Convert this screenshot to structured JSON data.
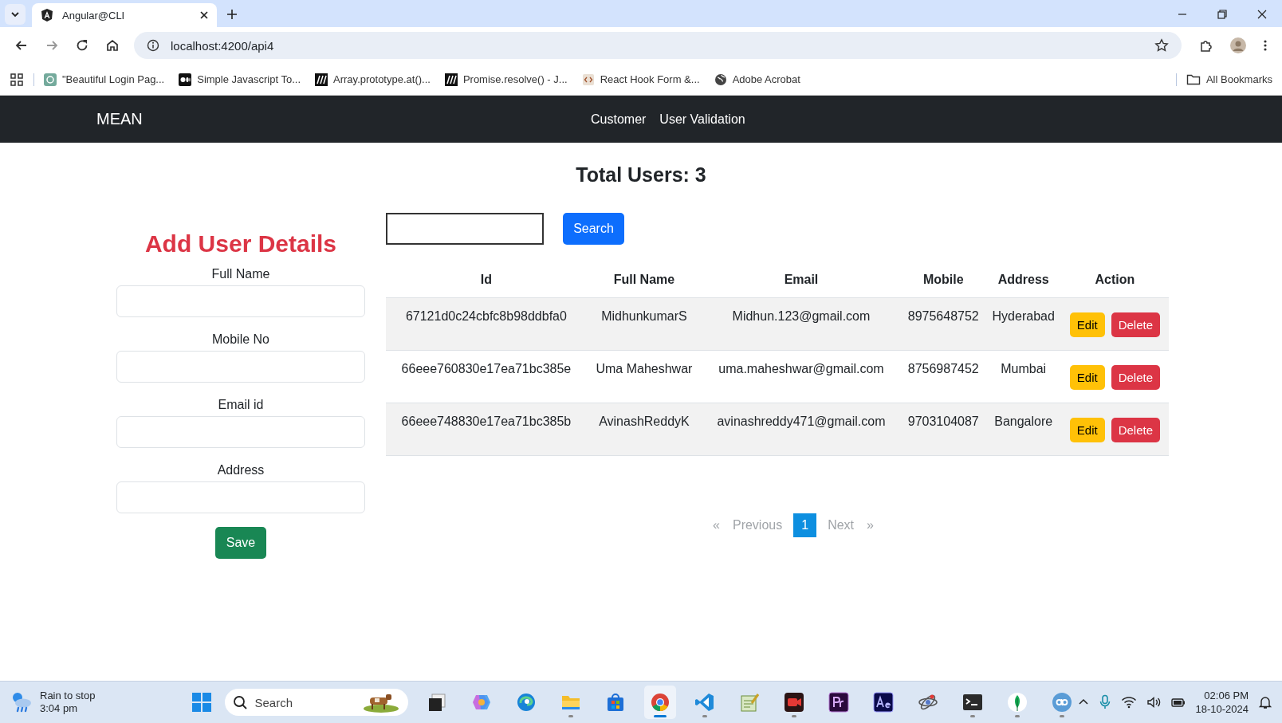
{
  "browser": {
    "tab": {
      "title": "Angular@CLI"
    },
    "address": "localhost:4200/api4",
    "bookmarks": [
      {
        "label": "\"Beautiful Login Pag...",
        "kind": "chat"
      },
      {
        "label": "Simple Javascript To...",
        "kind": "medium"
      },
      {
        "label": "Array.prototype.at()...",
        "kind": "mdn"
      },
      {
        "label": "Promise.resolve() - J...",
        "kind": "mdn"
      },
      {
        "label": "React Hook Form &...",
        "kind": "code"
      },
      {
        "label": "Adobe Acrobat",
        "kind": "globe"
      }
    ],
    "all_bookmarks": "All Bookmarks"
  },
  "navbar": {
    "brand": "MEAN",
    "links": [
      {
        "label": "Customer"
      },
      {
        "label": "User Validation"
      }
    ]
  },
  "heading": "Total Users: 3",
  "form": {
    "title": "Add User Details",
    "fields": [
      {
        "label": "Full Name"
      },
      {
        "label": "Mobile No"
      },
      {
        "label": "Email id"
      },
      {
        "label": "Address"
      }
    ],
    "save": "Save"
  },
  "search": {
    "button": "Search"
  },
  "table": {
    "columns": [
      "Id",
      "Full Name",
      "Email",
      "Mobile",
      "Address",
      "Action"
    ],
    "rows": [
      {
        "cells": [
          "67121d0c24cbfc8b98ddbfa0",
          "MidhunkumarS",
          "Midhun.123@gmail.com",
          "8975648752",
          "Hyderabad"
        ],
        "edit": "Edit",
        "delete": "Delete"
      },
      {
        "cells": [
          "66eee760830e17ea71bc385e",
          "Uma Maheshwar",
          "uma.maheshwar@gmail.com",
          "8756987452",
          "Mumbai"
        ],
        "edit": "Edit",
        "delete": "Delete"
      },
      {
        "cells": [
          "66eee748830e17ea71bc385b",
          "AvinashReddyK",
          "avinashreddy471@gmail.com",
          "9703104087",
          "Bangalore"
        ],
        "edit": "Edit",
        "delete": "Delete"
      }
    ]
  },
  "pagination": [
    {
      "label": "«",
      "selected": false,
      "disabled": true
    },
    {
      "label": "Previous",
      "selected": false,
      "disabled": true
    },
    {
      "label": "1",
      "selected": true,
      "disabled": false
    },
    {
      "label": "Next",
      "selected": false,
      "disabled": true
    },
    {
      "label": "»",
      "selected": false,
      "disabled": true
    }
  ],
  "taskbar": {
    "weather": {
      "title": "Rain to stop",
      "time": "3:04 pm"
    },
    "search": {
      "placeholder": "Search"
    },
    "apps": [
      {
        "kind": "files-stack",
        "running": false,
        "selected": false
      },
      {
        "kind": "copilot",
        "running": false,
        "selected": false
      },
      {
        "kind": "edge",
        "running": false,
        "selected": false
      },
      {
        "kind": "folder",
        "running": true,
        "selected": false
      },
      {
        "kind": "store",
        "running": false,
        "selected": false
      },
      {
        "kind": "chrome",
        "running": true,
        "selected": true
      },
      {
        "kind": "vscode",
        "running": true,
        "selected": false
      },
      {
        "kind": "notepad",
        "running": false,
        "selected": false
      },
      {
        "kind": "recorder",
        "running": true,
        "selected": false
      },
      {
        "kind": "pr",
        "running": false,
        "selected": false
      },
      {
        "kind": "ae",
        "running": false,
        "selected": false
      },
      {
        "kind": "atom",
        "running": false,
        "selected": false
      },
      {
        "kind": "terminal",
        "running": true,
        "selected": false
      },
      {
        "kind": "leaf",
        "running": true,
        "selected": false
      },
      {
        "kind": "qb",
        "running": true,
        "selected": false
      }
    ],
    "clock": {
      "time": "02:06 PM",
      "date": "18-10-2024"
    }
  }
}
